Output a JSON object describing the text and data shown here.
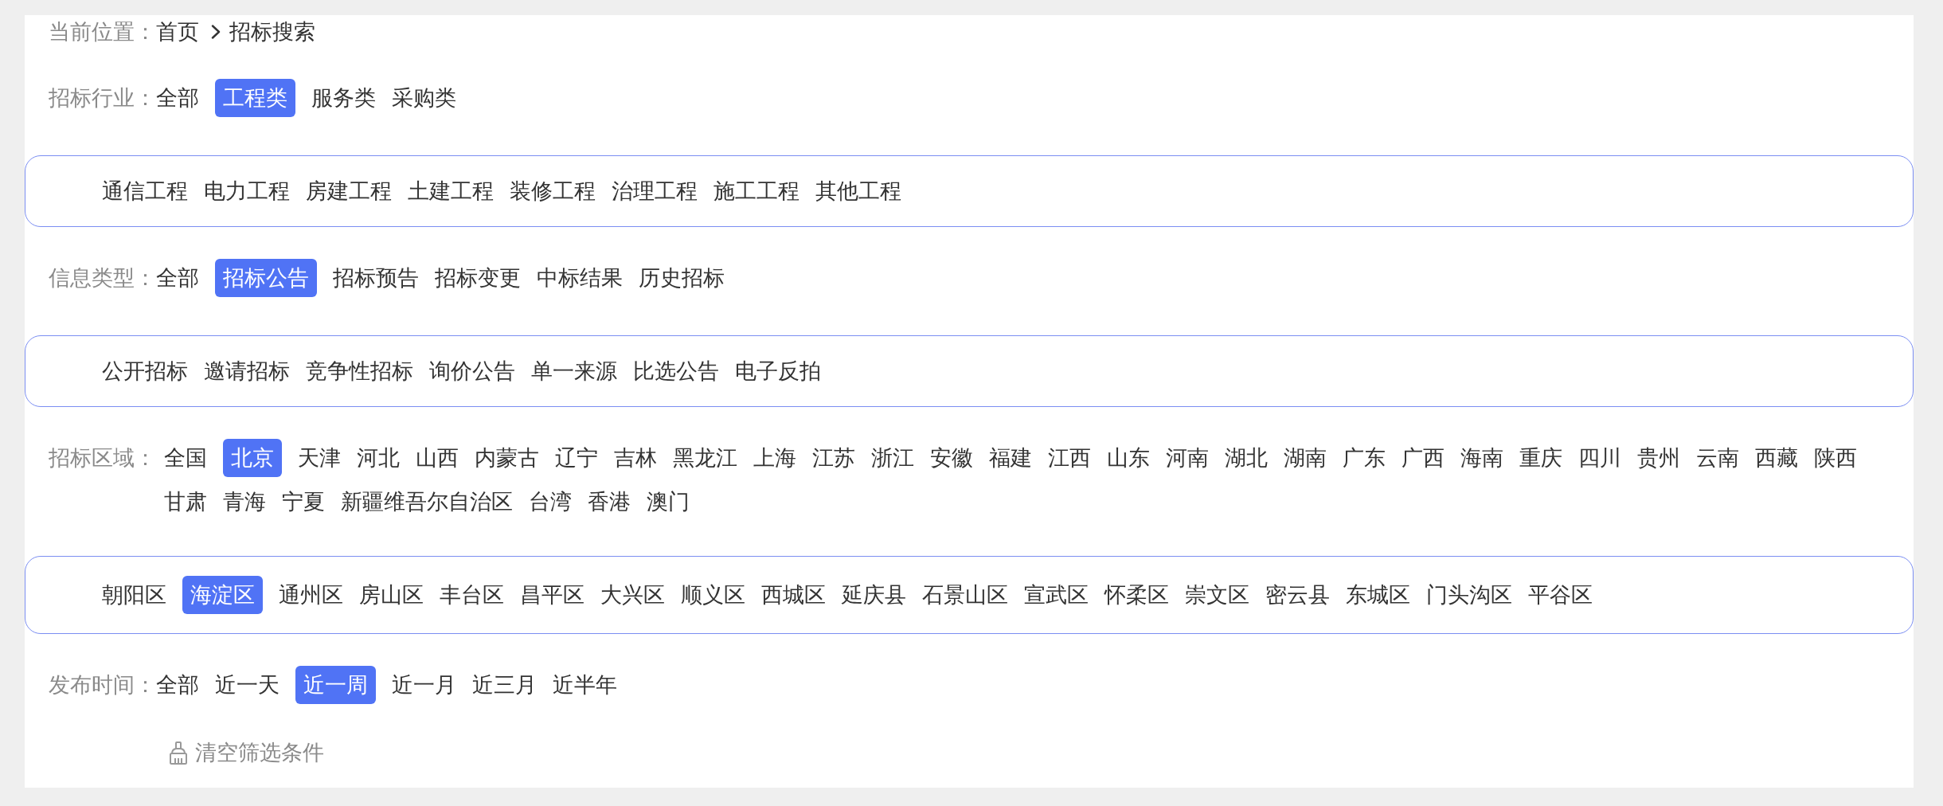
{
  "breadcrumb": {
    "label": "当前位置：",
    "items": [
      {
        "text": "首页"
      },
      {
        "text": "招标搜索"
      }
    ]
  },
  "filters": [
    {
      "label": "招标行业：",
      "options": [
        {
          "text": "全部",
          "selected": false
        },
        {
          "text": "工程类",
          "selected": true
        },
        {
          "text": "服务类",
          "selected": false
        },
        {
          "text": "采购类",
          "selected": false
        }
      ],
      "subpanel": {
        "options": [
          {
            "text": "通信工程",
            "selected": false
          },
          {
            "text": "电力工程",
            "selected": false
          },
          {
            "text": "房建工程",
            "selected": false
          },
          {
            "text": "土建工程",
            "selected": false
          },
          {
            "text": "装修工程",
            "selected": false
          },
          {
            "text": "治理工程",
            "selected": false
          },
          {
            "text": "施工工程",
            "selected": false
          },
          {
            "text": "其他工程",
            "selected": false
          }
        ]
      }
    },
    {
      "label": "信息类型：",
      "options": [
        {
          "text": "全部",
          "selected": false
        },
        {
          "text": "招标公告",
          "selected": true
        },
        {
          "text": "招标预告",
          "selected": false
        },
        {
          "text": "招标变更",
          "selected": false
        },
        {
          "text": "中标结果",
          "selected": false
        },
        {
          "text": "历史招标",
          "selected": false
        }
      ],
      "subpanel": {
        "options": [
          {
            "text": "公开招标",
            "selected": false
          },
          {
            "text": "邀请招标",
            "selected": false
          },
          {
            "text": "竞争性招标",
            "selected": false
          },
          {
            "text": "询价公告",
            "selected": false
          },
          {
            "text": "单一来源",
            "selected": false
          },
          {
            "text": "比选公告",
            "selected": false
          },
          {
            "text": "电子反拍",
            "selected": false
          }
        ]
      }
    },
    {
      "label": "招标区域：",
      "options": [
        {
          "text": "全国",
          "selected": false
        },
        {
          "text": "北京",
          "selected": true
        },
        {
          "text": "天津",
          "selected": false
        },
        {
          "text": "河北",
          "selected": false
        },
        {
          "text": "山西",
          "selected": false
        },
        {
          "text": "内蒙古",
          "selected": false
        },
        {
          "text": "辽宁",
          "selected": false
        },
        {
          "text": "吉林",
          "selected": false
        },
        {
          "text": "黑龙江",
          "selected": false
        },
        {
          "text": "上海",
          "selected": false
        },
        {
          "text": "江苏",
          "selected": false
        },
        {
          "text": "浙江",
          "selected": false
        },
        {
          "text": "安徽",
          "selected": false
        },
        {
          "text": "福建",
          "selected": false
        },
        {
          "text": "江西",
          "selected": false
        },
        {
          "text": "山东",
          "selected": false
        },
        {
          "text": "河南",
          "selected": false
        },
        {
          "text": "湖北",
          "selected": false
        },
        {
          "text": "湖南",
          "selected": false
        },
        {
          "text": "广东",
          "selected": false
        },
        {
          "text": "广西",
          "selected": false
        },
        {
          "text": "海南",
          "selected": false
        },
        {
          "text": "重庆",
          "selected": false
        },
        {
          "text": "四川",
          "selected": false
        },
        {
          "text": "贵州",
          "selected": false
        },
        {
          "text": "云南",
          "selected": false
        },
        {
          "text": "西藏",
          "selected": false
        },
        {
          "text": "陕西",
          "selected": false
        },
        {
          "text": "甘肃",
          "selected": false
        },
        {
          "text": "青海",
          "selected": false
        },
        {
          "text": "宁夏",
          "selected": false
        },
        {
          "text": "新疆维吾尔自治区",
          "selected": false
        },
        {
          "text": "台湾",
          "selected": false
        },
        {
          "text": "香港",
          "selected": false
        },
        {
          "text": "澳门",
          "selected": false
        }
      ],
      "subpanel": {
        "options": [
          {
            "text": "朝阳区",
            "selected": false
          },
          {
            "text": "海淀区",
            "selected": true
          },
          {
            "text": "通州区",
            "selected": false
          },
          {
            "text": "房山区",
            "selected": false
          },
          {
            "text": "丰台区",
            "selected": false
          },
          {
            "text": "昌平区",
            "selected": false
          },
          {
            "text": "大兴区",
            "selected": false
          },
          {
            "text": "顺义区",
            "selected": false
          },
          {
            "text": "西城区",
            "selected": false
          },
          {
            "text": "延庆县",
            "selected": false
          },
          {
            "text": "石景山区",
            "selected": false
          },
          {
            "text": "宣武区",
            "selected": false
          },
          {
            "text": "怀柔区",
            "selected": false
          },
          {
            "text": "崇文区",
            "selected": false
          },
          {
            "text": "密云县",
            "selected": false
          },
          {
            "text": "东城区",
            "selected": false
          },
          {
            "text": "门头沟区",
            "selected": false
          },
          {
            "text": "平谷区",
            "selected": false
          }
        ]
      }
    },
    {
      "label": "发布时间：",
      "options": [
        {
          "text": "全部",
          "selected": false
        },
        {
          "text": "近一天",
          "selected": false
        },
        {
          "text": "近一周",
          "selected": true
        },
        {
          "text": "近一月",
          "selected": false
        },
        {
          "text": "近三月",
          "selected": false
        },
        {
          "text": "近半年",
          "selected": false
        }
      ]
    }
  ],
  "clear_button": {
    "label": "清空筛选条件"
  }
}
